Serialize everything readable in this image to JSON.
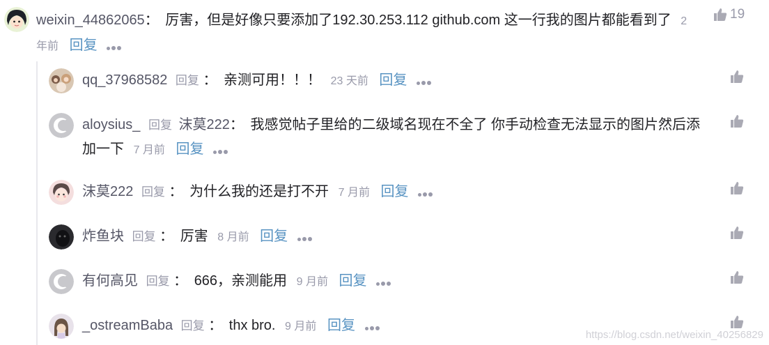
{
  "main_comment": {
    "username": "weixin_44862065",
    "separator": "：",
    "content": "厉害，但是好像只要添加了192.30.253.112 github.com 这一行我的图片都能看到了",
    "time": "2 年前",
    "reply_label": "回复",
    "like_count": "19"
  },
  "replies": [
    {
      "username": "qq_37968582",
      "reply_word": "回复",
      "to_user": "",
      "separator": "：",
      "content": "亲测可用！！！",
      "time": "23 天前",
      "reply_label": "回复"
    },
    {
      "username": "aloysius_",
      "reply_word": "回复",
      "to_user": "沫莫222",
      "separator": "：",
      "content": "我感觉帖子里给的二级域名现在不全了 你手动检查无法显示的图片然后添加一下",
      "time": "7 月前",
      "reply_label": "回复"
    },
    {
      "username": "沫莫222",
      "reply_word": "回复",
      "to_user": "",
      "separator": "：",
      "content": "为什么我的还是打不开",
      "time": "7 月前",
      "reply_label": "回复"
    },
    {
      "username": "炸鱼块",
      "reply_word": "回复",
      "to_user": "",
      "separator": "：",
      "content": "厉害",
      "time": "8 月前",
      "reply_label": "回复"
    },
    {
      "username": "有何高见",
      "reply_word": "回复",
      "to_user": "",
      "separator": "：",
      "content": "666，亲测能用",
      "time": "9 月前",
      "reply_label": "回复"
    },
    {
      "username": "_ostreamBaba",
      "reply_word": "回复",
      "to_user": "",
      "separator": "：",
      "content": "thx bro.",
      "time": "9 月前",
      "reply_label": "回复"
    }
  ],
  "watermark": "https://blog.csdn.net/weixin_40256829",
  "colors": {
    "username": "#555666",
    "reply_link": "#5893c2",
    "muted": "#999aaa",
    "text": "#222226"
  }
}
